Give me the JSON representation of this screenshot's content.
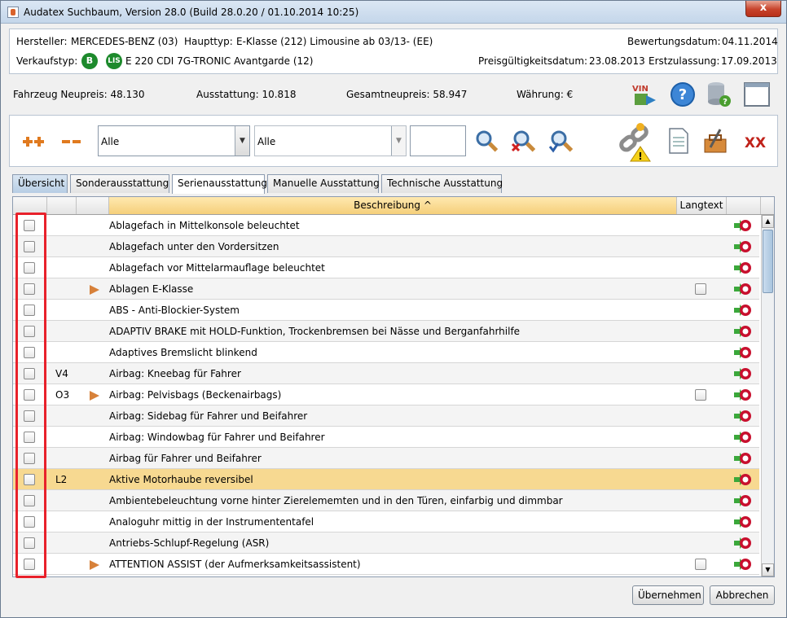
{
  "window": {
    "title": "Audatex Suchbaum, Version 28.0 (Build 28.0.20 / 01.10.2014 10:25)",
    "close": "x"
  },
  "info": {
    "hersteller_label": "Hersteller:",
    "hersteller_value": "MERCEDES-BENZ (03)",
    "haupttyp_label": "Haupttyp:",
    "haupttyp_value": "E-Klasse (212) Limousine ab 03/13- (EE)",
    "bewertungsdatum_label": "Bewertungsdatum:",
    "bewertungsdatum_value": "04.11.2014",
    "verkaufstyp_label": "Verkaufstyp:",
    "badge_b": "B",
    "badge_lis": "LIS",
    "verkaufstyp_value": "E 220 CDI 7G-TRONIC Avantgarde (12)",
    "preisgueltigkeit_label": "Preisgültigkeitsdatum:",
    "preisgueltigkeit_value": "23.08.2013",
    "erstzulassung_label": "Erstzulassung:",
    "erstzulassung_value": "17.09.2013"
  },
  "prices": {
    "neupreis": "Fahrzeug Neupreis: 48.130",
    "ausstattung": "Ausstattung: 10.818",
    "gesamt": "Gesamtneupreis: 58.947",
    "waehrung": "Währung: €"
  },
  "toolbar": {
    "vin_label": "VIN"
  },
  "filter": {
    "combo1": "Alle",
    "combo2": "Alle",
    "text": "",
    "delete_label": "XX"
  },
  "tabs": [
    "Übersicht",
    "Sonderausstattung",
    "Serienausstattung",
    "Manuelle Ausstattung",
    "Technische Ausstattung"
  ],
  "table": {
    "headers": {
      "beschreibung": "Beschreibung ^",
      "langtext": "Langtext"
    },
    "rows": [
      {
        "code": "",
        "arrow": false,
        "desc": "Ablagefach in Mittelkonsole beleuchtet",
        "langtext": false
      },
      {
        "code": "",
        "arrow": false,
        "desc": "Ablagefach unter den Vordersitzen",
        "langtext": false
      },
      {
        "code": "",
        "arrow": false,
        "desc": "Ablagefach vor Mittelarmauflage beleuchtet",
        "langtext": false
      },
      {
        "code": "",
        "arrow": true,
        "desc": "Ablagen E-Klasse",
        "langtext": true
      },
      {
        "code": "",
        "arrow": false,
        "desc": "ABS - Anti-Blockier-System",
        "langtext": false
      },
      {
        "code": "",
        "arrow": false,
        "desc": "ADAPTIV BRAKE mit HOLD-Funktion, Trockenbremsen bei Nässe und Berganfahrhilfe",
        "langtext": false
      },
      {
        "code": "",
        "arrow": false,
        "desc": "Adaptives Bremslicht blinkend",
        "langtext": false
      },
      {
        "code": "V4",
        "arrow": false,
        "desc": "Airbag: Kneebag für Fahrer",
        "langtext": false
      },
      {
        "code": "O3",
        "arrow": true,
        "desc": "Airbag: Pelvisbags (Beckenairbags)",
        "langtext": true
      },
      {
        "code": "",
        "arrow": false,
        "desc": "Airbag: Sidebag für Fahrer und Beifahrer",
        "langtext": false
      },
      {
        "code": "",
        "arrow": false,
        "desc": "Airbag: Windowbag für Fahrer und Beifahrer",
        "langtext": false
      },
      {
        "code": "",
        "arrow": false,
        "desc": "Airbag für Fahrer und Beifahrer",
        "langtext": false
      },
      {
        "code": "L2",
        "arrow": false,
        "desc": "Aktive Motorhaube reversibel",
        "langtext": false,
        "selected": true
      },
      {
        "code": "",
        "arrow": false,
        "desc": "Ambientebeleuchtung vorne hinter Zierelememten und in den Türen, einfarbig und dimmbar",
        "langtext": false
      },
      {
        "code": "",
        "arrow": false,
        "desc": "Analoguhr mittig in der Instrumententafel",
        "langtext": false
      },
      {
        "code": "",
        "arrow": false,
        "desc": "Antriebs-Schlupf-Regelung (ASR)",
        "langtext": false
      },
      {
        "code": "",
        "arrow": true,
        "desc": "ATTENTION ASSIST (der Aufmerksamkeitsassistent)",
        "langtext": true
      }
    ]
  },
  "buttons": {
    "ok": "Übernehmen",
    "cancel": "Abbrechen"
  },
  "colors": {
    "selected_row": "#f7d991",
    "header_sort": "#f5cf7a",
    "badge_green": "#1d8a2c",
    "highlight": "#e8212b"
  }
}
